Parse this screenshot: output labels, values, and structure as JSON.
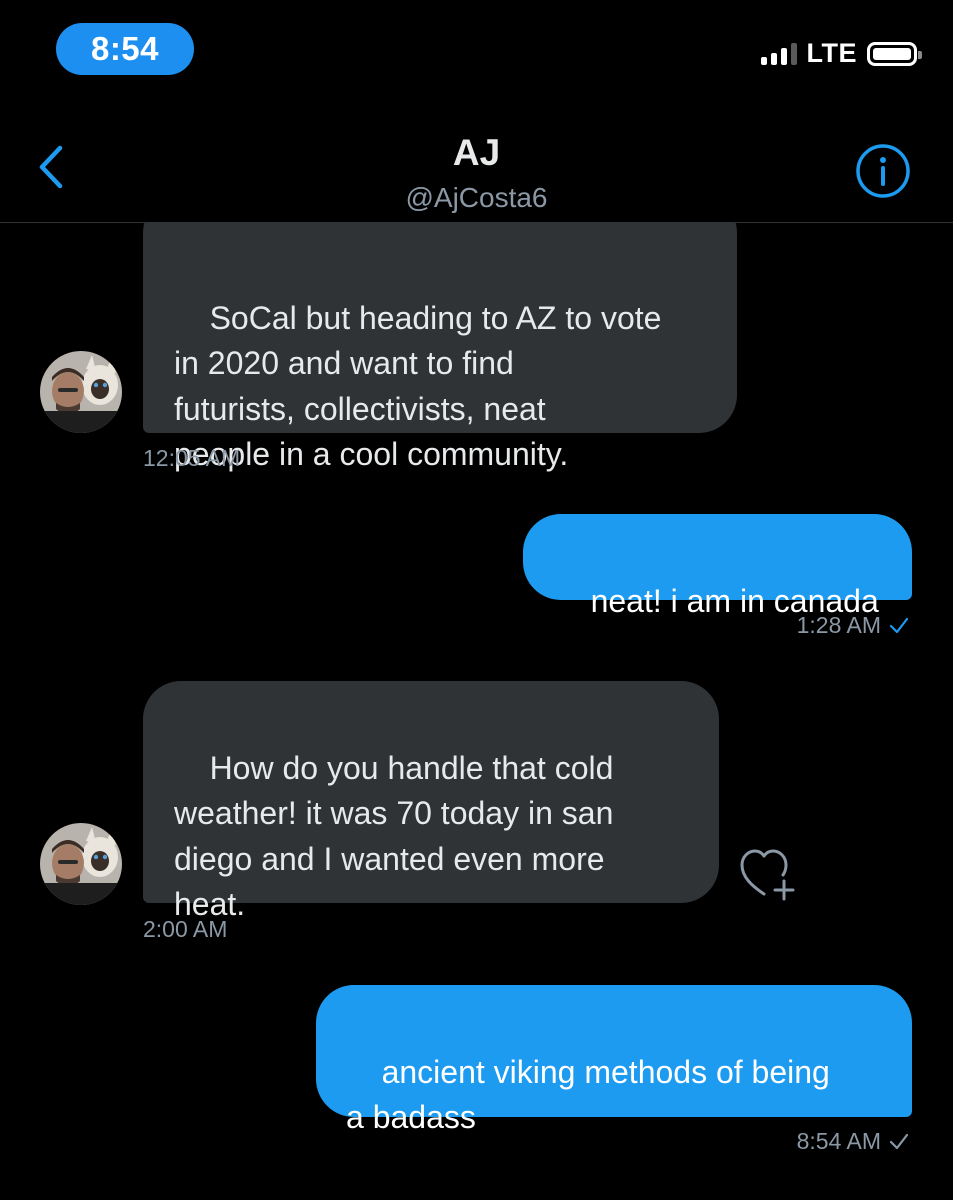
{
  "status_bar": {
    "time": "8:54",
    "network": "LTE"
  },
  "header": {
    "name": "AJ",
    "handle": "@AjCosta6"
  },
  "messages": [
    {
      "direction": "received",
      "text": "SoCal but heading to AZ to vote\nin 2020 and want to find\nfuturists, collectivists, neat\npeople in a cool community.",
      "time": "12:05 AM"
    },
    {
      "direction": "sent",
      "text": "neat! i am in canada",
      "time": "1:28 AM",
      "status_icon": "check-icon",
      "status_color": "#1d9bf0"
    },
    {
      "direction": "received",
      "text": "How do you handle that cold\nweather! it was 70 today in san\ndiego and I wanted even more\nheat.",
      "time": "2:00 AM"
    },
    {
      "direction": "sent",
      "text": "ancient viking methods of being\na badass",
      "time": "8:54 AM",
      "status_icon": "check-icon",
      "status_color": "#8b98a5"
    }
  ],
  "colors": {
    "accent": "#1d9bf0",
    "received_bubble": "#2f3336",
    "background": "#000000",
    "secondary_text": "#8b98a5"
  }
}
